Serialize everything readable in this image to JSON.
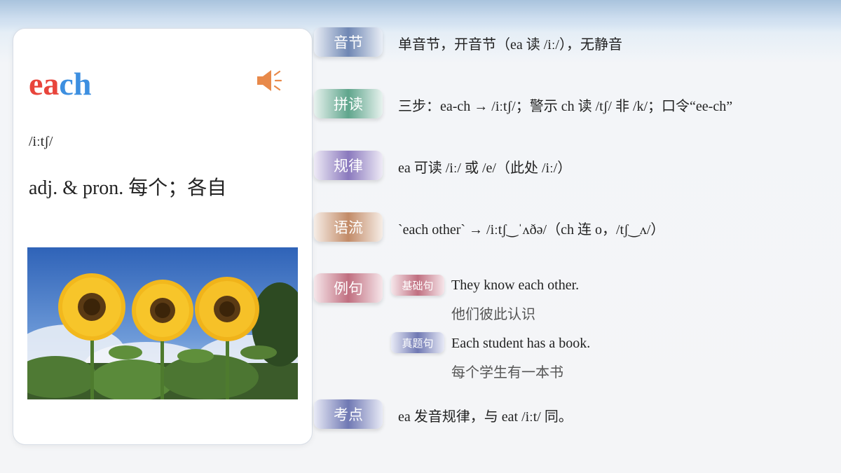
{
  "card": {
    "word_part1": "ea",
    "word_part2": "ch",
    "phonetic": "/iːtʃ/",
    "meaning": "adj. & pron. 每个；各自",
    "speaker_icon": "speaker-icon",
    "image": "sunflowers"
  },
  "colors": {
    "word_ea": "#e8453c",
    "word_ch": "#3d8fe0",
    "speaker": "#e8894a"
  },
  "sections": [
    {
      "label": "音节",
      "text": "单音节，开音节（ea 读 /iː/），无静音"
    },
    {
      "label": "拼读",
      "text": "三步：ea-ch → /iːtʃ/；警示 ch 读 /tʃ/ 非 /k/；口令“ee-ch”"
    },
    {
      "label": "规律",
      "text": "ea 可读 /iː/ 或 /e/（此处 /iː/）"
    },
    {
      "label": "语流",
      "text": "`each other` → /iːtʃ‿ˈʌðə/（ch 连 o，/tʃ‿ʌ/）"
    },
    {
      "label": "例句",
      "text": ""
    },
    {
      "label": "考点",
      "text": "ea 发音规律，与 eat /iːt/ 同。"
    }
  ],
  "examples": [
    {
      "tag": "基础句",
      "en": "They know each other.",
      "zh": "他们彼此认识"
    },
    {
      "tag": "真题句",
      "en": "Each student has a book.",
      "zh": "每个学生有一本书"
    }
  ]
}
